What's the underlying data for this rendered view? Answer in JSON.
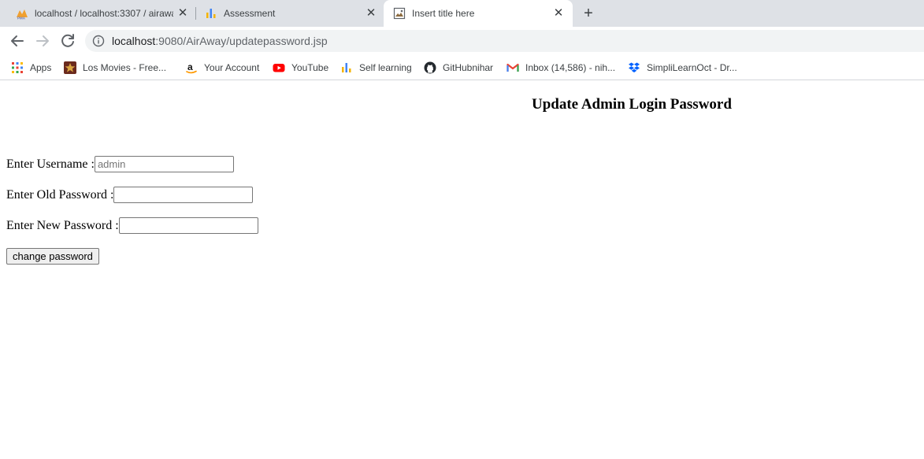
{
  "browser": {
    "tabs": [
      {
        "title": "localhost / localhost:3307 / airaway",
        "icon": "phpmyadmin-icon",
        "active": false
      },
      {
        "title": "Assessment",
        "icon": "bar-chart-icon",
        "active": false
      },
      {
        "title": "Insert title here",
        "icon": "broken-image-icon",
        "active": true
      }
    ],
    "url_host": "localhost",
    "url_rest": ":9080/AirAway/updatepassword.jsp",
    "bookmarks": [
      {
        "label": "Apps",
        "icon": "apps-grid-icon"
      },
      {
        "label": "Los Movies - Free...",
        "icon": "movie-icon"
      },
      {
        "label": "Your Account",
        "icon": "amazon-icon"
      },
      {
        "label": "YouTube",
        "icon": "youtube-icon"
      },
      {
        "label": "Self learning",
        "icon": "bar-chart-icon"
      },
      {
        "label": "GitHubnihar",
        "icon": "github-icon"
      },
      {
        "label": "Inbox (14,586) - nih...",
        "icon": "gmail-icon"
      },
      {
        "label": "SimpliLearnOct - Dr...",
        "icon": "dropbox-icon"
      }
    ]
  },
  "page": {
    "heading": "Update Admin Login Password",
    "username_label": "Enter Username : ",
    "username_placeholder": "admin",
    "old_password_label": "Enter Old Password :",
    "old_password_value": "",
    "new_password_label": "Enter New Password :",
    "new_password_value": "",
    "submit_label": "change password"
  }
}
